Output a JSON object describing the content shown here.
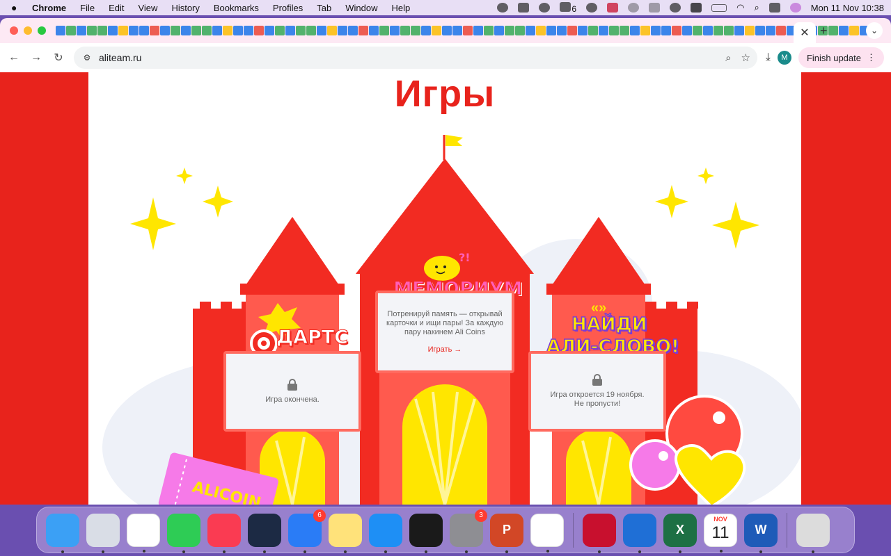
{
  "menubar": {
    "app_name": "Chrome",
    "menus": [
      "File",
      "Edit",
      "View",
      "History",
      "Bookmarks",
      "Profiles",
      "Tab",
      "Window",
      "Help"
    ],
    "badge_count": "6",
    "datetime": "Mon 11 Nov  10:38"
  },
  "browser": {
    "url": "aliteam.ru",
    "finish_update_label": "Finish update",
    "avatar_letter": "M",
    "close_tab_glyph": "✕",
    "new_tab_glyph": "+"
  },
  "page": {
    "title": "Игры",
    "games": {
      "darts": {
        "name": "ДАРТС",
        "status": "Игра окончена."
      },
      "memorium": {
        "name": "МЕМОРИУМ",
        "description": "Потренируй память — открывай карточки и ищи пары! За каждую пару накинем Ali Coins",
        "play_label": "Играть →"
      },
      "find_word": {
        "name_line1": "НАЙДИ",
        "name_line2": "АЛИ-СЛОВО!",
        "status_line1": "Игра откроется 19 ноября.",
        "status_line2": "Не пропусти!"
      }
    },
    "ticket_text": "ALICOIN"
  },
  "dock": {
    "items": [
      {
        "name": "finder",
        "color": "#3ba0f5"
      },
      {
        "name": "launchpad",
        "color": "#d9dde6"
      },
      {
        "name": "photos",
        "color": "#ffffff"
      },
      {
        "name": "facetime",
        "color": "#2ecc55"
      },
      {
        "name": "music",
        "color": "#fa3b52"
      },
      {
        "name": "app-dark",
        "color": "#1c2a44"
      },
      {
        "name": "app-blue",
        "color": "#2a7cf6",
        "badge": "6"
      },
      {
        "name": "notes",
        "color": "#ffe27a"
      },
      {
        "name": "app-store",
        "color": "#1e8ff5"
      },
      {
        "name": "app-hex",
        "color": "#1a1a1a"
      },
      {
        "name": "system-settings",
        "color": "#8e8e93",
        "badge": "3"
      },
      {
        "name": "powerpoint",
        "color": "#d24726",
        "label": "P"
      },
      {
        "name": "chrome",
        "color": "#ffffff"
      },
      {
        "name": "acrobat",
        "color": "#c8102e"
      },
      {
        "name": "shield-app",
        "color": "#1f6fd6"
      },
      {
        "name": "excel",
        "color": "#1d7044",
        "label": "X"
      },
      {
        "name": "calendar",
        "color": "#ffffff",
        "month": "NOV",
        "day": "11"
      },
      {
        "name": "word",
        "color": "#1e5bb8",
        "label": "W"
      },
      {
        "name": "trash",
        "color": "#dcdcdc"
      }
    ]
  },
  "colors": {
    "brand_red": "#e8231c",
    "castle_red": "#f22b22",
    "castle_light": "#ff6a5f",
    "star_yellow": "#ffe600",
    "memorium_pink": "#ff5fb8"
  }
}
